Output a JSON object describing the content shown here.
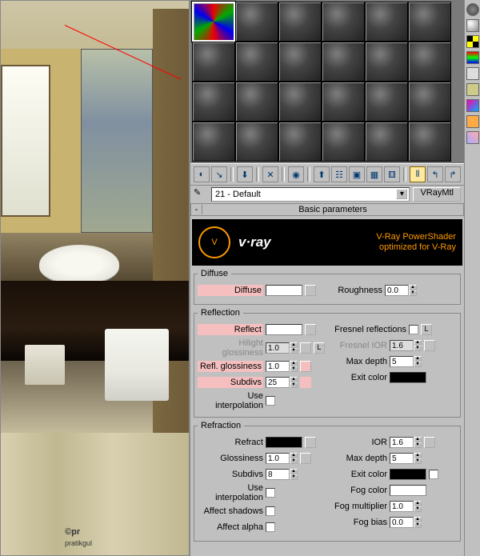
{
  "viewport": {
    "logo_text": "©pr",
    "logo_sub": "pratikgul"
  },
  "nameRow": {
    "material_name": "21 - Default",
    "type_button": "VRayMtl",
    "eyedrop_icon": "eyedrop"
  },
  "rollout": {
    "minus": "-",
    "title": "Basic parameters"
  },
  "banner": {
    "brand": "v·ray",
    "glyph": "V",
    "line1": "V-Ray PowerShader",
    "line2": "optimized for V-Ray"
  },
  "diffuse": {
    "legend": "Diffuse",
    "diffuse_label": "Diffuse",
    "roughness_label": "Roughness",
    "roughness_value": "0.0"
  },
  "reflection": {
    "legend": "Reflection",
    "reflect_label": "Reflect",
    "hilight_label": "Hilight glossiness",
    "hilight_value": "1.0",
    "l_btn": "L",
    "refl_gloss_label": "Refl. glossiness",
    "refl_gloss_value": "1.0",
    "subdivs_label": "Subdivs",
    "subdivs_value": "25",
    "use_interp_label": "Use interpolation",
    "fresnel_label": "Fresnel reflections",
    "fresnel_ior_label": "Fresnel IOR",
    "fresnel_ior_value": "1.6",
    "max_depth_label": "Max depth",
    "max_depth_value": "5",
    "exit_color_label": "Exit color"
  },
  "refraction": {
    "legend": "Refraction",
    "refract_label": "Refract",
    "glossiness_label": "Glossiness",
    "glossiness_value": "1.0",
    "subdivs_label": "Subdivs",
    "subdivs_value": "8",
    "use_interp_label": "Use interpolation",
    "affect_shadows_label": "Affect shadows",
    "affect_alpha_label": "Affect alpha",
    "ior_label": "IOR",
    "ior_value": "1.6",
    "max_depth_label": "Max depth",
    "max_depth_value": "5",
    "exit_color_label": "Exit color",
    "fog_color_label": "Fog color",
    "fog_mult_label": "Fog multiplier",
    "fog_mult_value": "1.0",
    "fog_bias_label": "Fog bias",
    "fog_bias_value": "0.0"
  },
  "toolbar": {
    "icons": [
      "get-material",
      "put-to-scene",
      "assign",
      "reset",
      "delete",
      "make-unique",
      "put-to-library",
      "material-effects",
      "show-map",
      "show-result",
      "options",
      "navigate-up",
      "navigate-fwd"
    ]
  },
  "sidebar": {
    "icons": [
      "sample-sphere",
      "backlight",
      "background",
      "checker",
      "color-correct",
      "video",
      "custom",
      "options",
      "select",
      "configure"
    ]
  }
}
